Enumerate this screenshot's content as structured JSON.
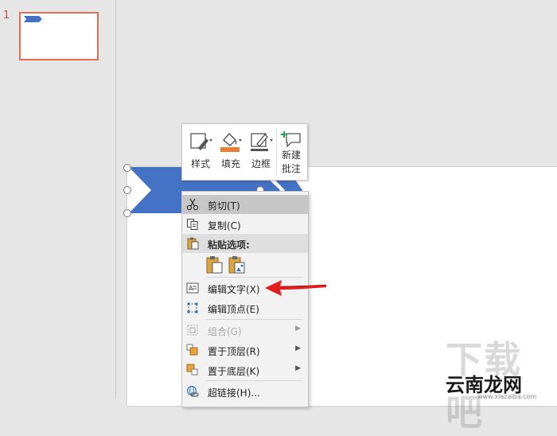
{
  "thumbnails": {
    "slide_number": "1"
  },
  "mini_toolbar": {
    "style_label": "样式",
    "fill_label": "填充",
    "border_label": "边框",
    "comment_label_1": "新建",
    "comment_label_2": "批注",
    "fill_color": "#ed7d31"
  },
  "context_menu": {
    "cut": "剪切(T)",
    "copy": "复制(C)",
    "paste_options": "粘贴选项:",
    "edit_text": "编辑文字(X)",
    "edit_points": "编辑顶点(E)",
    "group": "组合(G)",
    "bring_to_front": "置于顶层(R)",
    "send_to_back": "置于底层(K)",
    "hyperlink": "超链接(H)..."
  },
  "watermark": {
    "big": "下载吧",
    "brand": "云南龙网",
    "url": "www.xiazaiba.com"
  },
  "colors": {
    "shape_fill": "#4472c4",
    "selection_accent": "#e07050",
    "arrow_red": "#e21d1d"
  }
}
